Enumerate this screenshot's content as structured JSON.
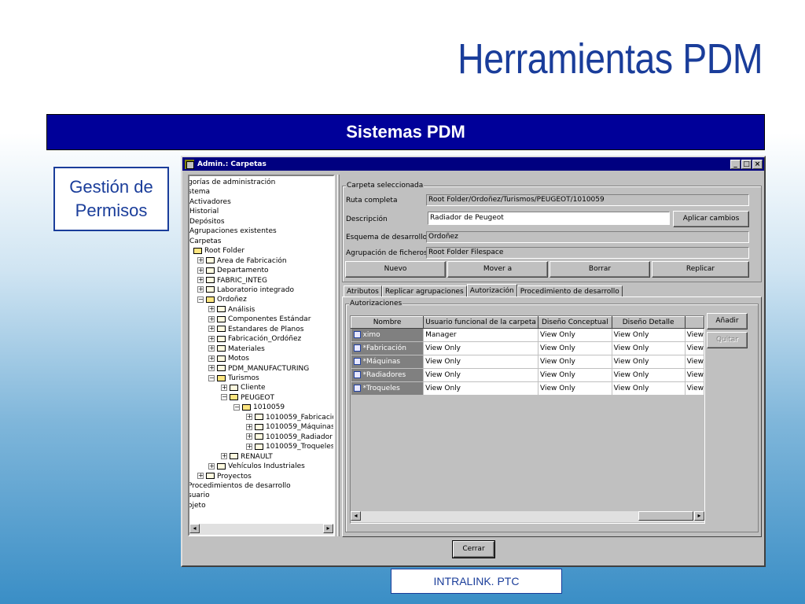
{
  "slide": {
    "title": "Herramientas PDM",
    "banner": "Sistemas PDM",
    "side_box_line1": "Gestión de",
    "side_box_line2": "Permisos",
    "footer": "INTRALINK. PTC"
  },
  "window": {
    "title": "Admin.: Carpetas",
    "minimize": "_",
    "maximize": "□",
    "close": "×"
  },
  "tree": {
    "items": [
      "gorías de administración",
      "stema",
      "Activadores",
      "Historial",
      "Depósitos",
      "Agrupaciones existentes",
      "Carpetas",
      "Root Folder",
      "Area de Fabricación",
      "Departamento",
      "FABRIC_INTEG",
      "Laboratorio integrado",
      "Ordoñez",
      "Análisis",
      "Componentes Estándar",
      "Estandares de Planos",
      "Fabricación_Ordóñez",
      "Materiales",
      "Motos",
      "PDM_MANUFACTURING",
      "Turismos",
      "Cliente",
      "PEUGEOT",
      "1010059",
      "1010059_Fabricacio",
      "1010059_Máquinas",
      "1010059_Radiador",
      "1010059_Troqueles",
      "RENAULT",
      "Vehículos Industriales",
      "Proyectos",
      "Procedimientos de desarrollo",
      "suario",
      "ojeto"
    ]
  },
  "folder": {
    "group_label": "Carpeta seleccionada",
    "ruta_label": "Ruta completa",
    "ruta_value": "Root Folder/Ordoñez/Turismos/PEUGEOT/1010059",
    "desc_label": "Descripción",
    "desc_value": "Radiador de Peugeot",
    "apply_label": "Aplicar cambios",
    "esquema_label": "Esquema de desarrollo",
    "esquema_value": "Ordoñez",
    "agrup_label": "Agrupación de ficheros",
    "agrup_value": "Root Folder Filespace",
    "nuevo": "Nuevo",
    "mover": "Mover a",
    "borrar": "Borrar",
    "replicar": "Replicar"
  },
  "tabs": [
    "Atributos",
    "Replicar agrupaciones",
    "Autorización",
    "Procedimiento de desarrollo"
  ],
  "auth": {
    "group_label": "Autorizaciones",
    "columns": [
      "Nombre",
      "Usuario funcional de la carpeta",
      "Diseño Conceptual",
      "Diseño Detalle",
      ""
    ],
    "rows": [
      [
        "ximo",
        "Manager",
        "View Only",
        "View Only",
        "View"
      ],
      [
        "*Fabricación",
        "View Only",
        "View Only",
        "View Only",
        "View"
      ],
      [
        "*Máquinas",
        "View Only",
        "View Only",
        "View Only",
        "View"
      ],
      [
        "*Radiadores",
        "View Only",
        "View Only",
        "View Only",
        "View"
      ],
      [
        "*Troqueles",
        "View Only",
        "View Only",
        "View Only",
        "View"
      ]
    ],
    "add_label": "Añadir",
    "remove_label": "Quitar"
  },
  "close_label": "Cerrar"
}
